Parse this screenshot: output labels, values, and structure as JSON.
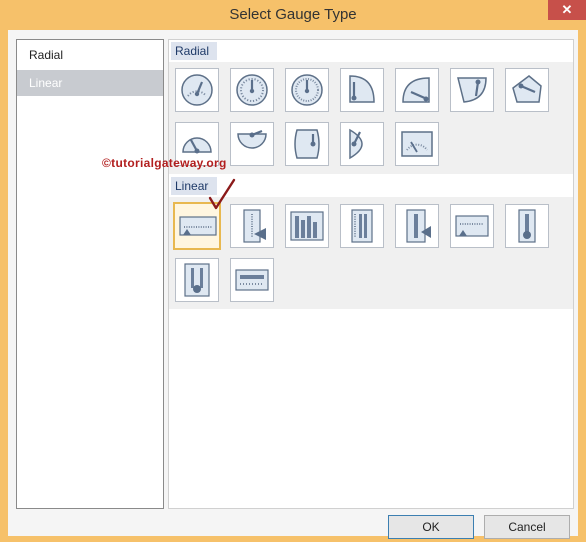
{
  "window": {
    "title": "Select Gauge Type",
    "close_symbol": "✕"
  },
  "sidebar": {
    "items": [
      {
        "label": "Radial",
        "selected": false
      },
      {
        "label": "Linear",
        "selected": true
      }
    ]
  },
  "content": {
    "sections": [
      {
        "header": "Radial",
        "tile_icons": [
          "radial-gauge-1-icon",
          "radial-gauge-2-icon",
          "radial-gauge-3-icon",
          "radial-gauge-4-icon",
          "radial-gauge-5-icon",
          "radial-gauge-6-icon",
          "radial-gauge-7-icon",
          "radial-gauge-8-icon",
          "radial-gauge-9-icon",
          "radial-gauge-10-icon",
          "radial-gauge-11-icon",
          "radial-gauge-12-icon"
        ]
      },
      {
        "header": "Linear",
        "tile_icons": [
          "linear-gauge-1-icon",
          "linear-gauge-2-icon",
          "linear-gauge-3-icon",
          "linear-gauge-4-icon",
          "linear-gauge-5-icon",
          "linear-gauge-6-icon",
          "linear-gauge-7-icon",
          "linear-gauge-8-icon",
          "linear-gauge-9-icon"
        ]
      }
    ],
    "selected_tile": "linear-gauge-1-icon"
  },
  "watermark": {
    "text": "©tutorialgateway.org"
  },
  "buttons": {
    "ok_label": "OK",
    "cancel_label": "Cancel"
  },
  "colors": {
    "frame": "#f6c16a",
    "close": "#c7504a",
    "selected_side": "#c8cbd0",
    "selected_tile_border": "#e8b850",
    "watermark": "#b21e1e",
    "checkmark": "#8b1a1a"
  }
}
